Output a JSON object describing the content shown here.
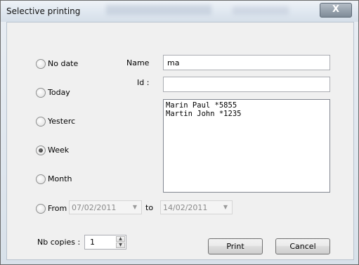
{
  "window": {
    "title": "Selective printing",
    "close_symbol": "X"
  },
  "radios": [
    {
      "label": "No date",
      "checked": false
    },
    {
      "label": "Today",
      "checked": false
    },
    {
      "label": "Yesterc",
      "checked": false
    },
    {
      "label": "Week",
      "checked": true
    },
    {
      "label": "Month",
      "checked": false
    },
    {
      "label": "From",
      "checked": false
    }
  ],
  "form": {
    "name_label": "Name",
    "name_value": "ma",
    "id_label": "Id :",
    "id_value": ""
  },
  "results": [
    "Marin Paul *5855",
    "Martin John *1235"
  ],
  "dates": {
    "from": "07/02/2011",
    "to_label": "to",
    "to": "14/02/2011"
  },
  "copies": {
    "label": "Nb copies :",
    "value": "1"
  },
  "buttons": {
    "print": "Print",
    "cancel": "Cancel"
  }
}
